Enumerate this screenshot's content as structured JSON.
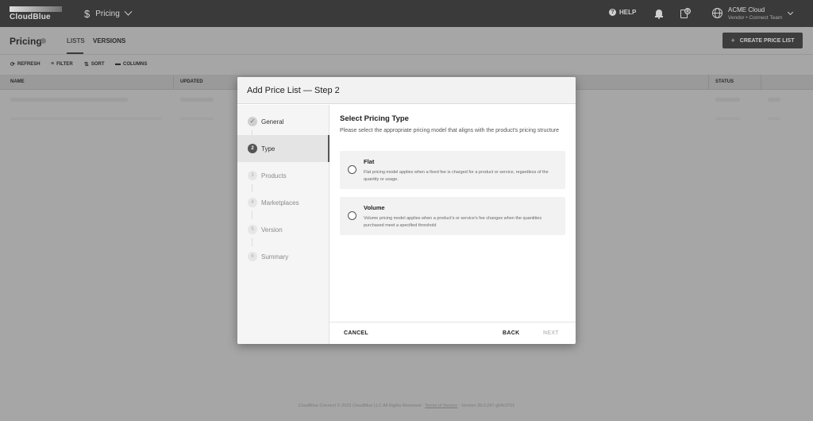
{
  "app": {
    "brand": "CloudBlue",
    "module": "Pricing",
    "help_label": "HELP",
    "tasks_badge": "0",
    "account_name": "ACME Cloud",
    "account_sub": "Vendor • Connect Team"
  },
  "page": {
    "title": "Pricing",
    "tabs": [
      "LISTS",
      "VERSIONS"
    ],
    "active_tab": "LISTS",
    "create_button": "CREATE PRICE LIST"
  },
  "toolbar": {
    "refresh": "REFRESH",
    "filter": "FILTER",
    "sort": "SORT",
    "columns": "COLUMNS"
  },
  "table": {
    "columns": [
      "NAME",
      "UPDATED",
      "STATUS"
    ]
  },
  "footer": {
    "text": "CloudBlue Connect © 2023 CloudBlue LLC All Rights Reserved",
    "terms": "Terms of Service",
    "version": "· Version 28.0.297-g04c3701"
  },
  "modal": {
    "title": "Add Price List — Step 2",
    "steps": [
      {
        "num": "✓",
        "label": "General",
        "state": "done"
      },
      {
        "num": "2",
        "label": "Type",
        "state": "current"
      },
      {
        "num": "3",
        "label": "Products",
        "state": "todo"
      },
      {
        "num": "4",
        "label": "Marketplaces",
        "state": "todo"
      },
      {
        "num": "5",
        "label": "Version",
        "state": "todo"
      },
      {
        "num": "6",
        "label": "Summary",
        "state": "todo"
      }
    ],
    "section_title": "Select Pricing Type",
    "section_desc": "Please select the appropriate pricing model that aligns with the product's pricing structure",
    "options": [
      {
        "title": "Flat",
        "desc": "Flat pricing model applies when a fixed fee is charged for a product or service, regardless of the quantity or usage.",
        "selected": false
      },
      {
        "title": "Volume",
        "desc": "Volume pricing model applies when a product's or service's fee changes when the quantities purchased meet a specified threshold",
        "selected": false
      }
    ],
    "cancel": "CANCEL",
    "back": "BACK",
    "next": "NEXT"
  }
}
